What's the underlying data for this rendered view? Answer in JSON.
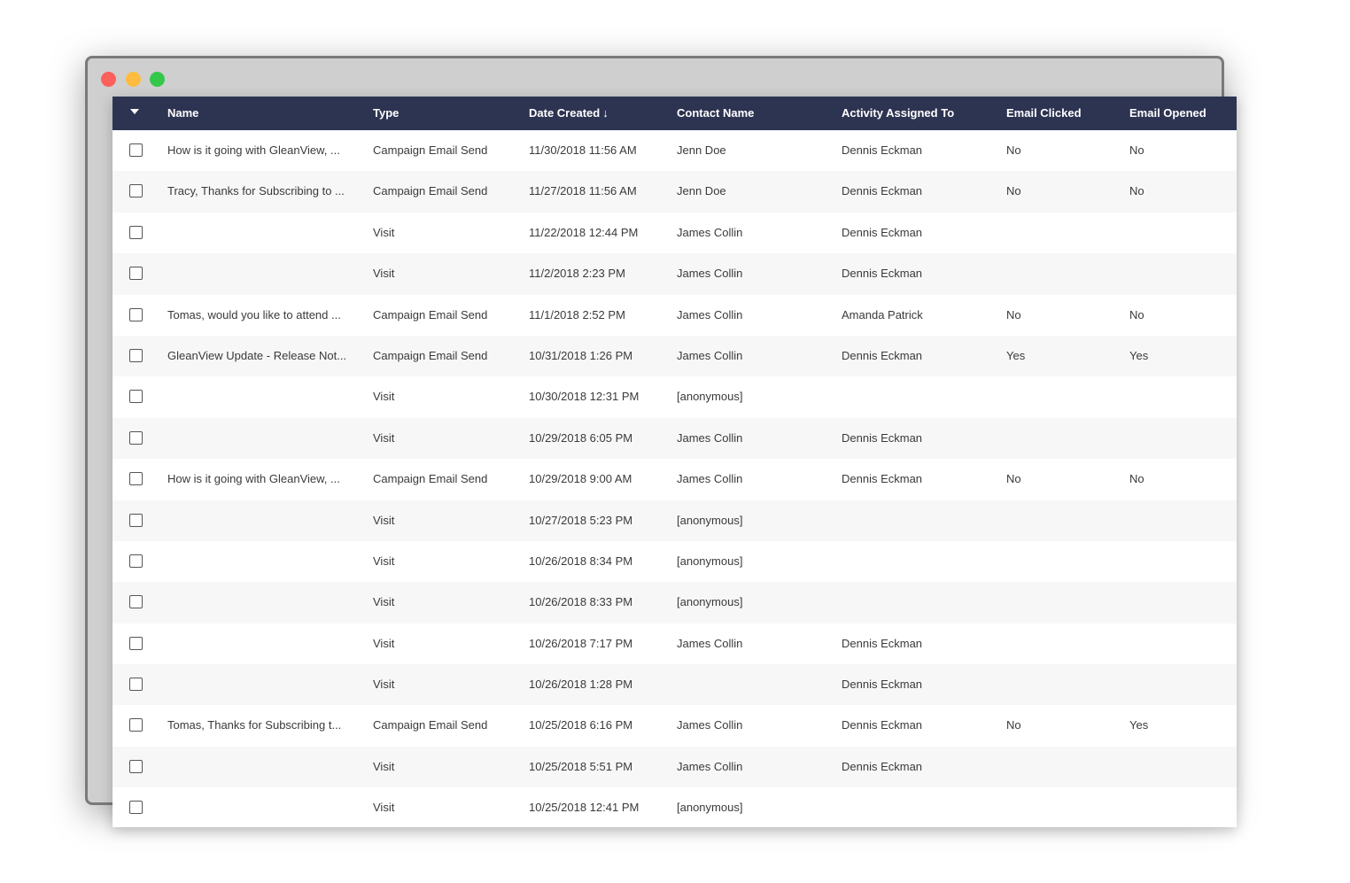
{
  "table": {
    "columns": {
      "name": "Name",
      "type": "Type",
      "date_created": "Date Created",
      "contact_name": "Contact Name",
      "activity_assigned_to": "Activity Assigned To",
      "email_clicked": "Email Clicked",
      "email_opened": "Email Opened"
    },
    "sort_indicator": "↓",
    "rows": [
      {
        "name": "How is it going with GleanView, ...",
        "type": "Campaign Email Send",
        "date": "11/30/2018 11:56 AM",
        "contact": "Jenn Doe",
        "assigned": "Dennis Eckman",
        "clicked": "No",
        "opened": "No"
      },
      {
        "name": "Tracy, Thanks for Subscribing to ...",
        "type": "Campaign Email Send",
        "date": "11/27/2018 11:56 AM",
        "contact": "Jenn Doe",
        "assigned": "Dennis Eckman",
        "clicked": "No",
        "opened": "No"
      },
      {
        "name": "",
        "type": "Visit",
        "date": "11/22/2018 12:44 PM",
        "contact": "James Collin",
        "assigned": "Dennis Eckman",
        "clicked": "",
        "opened": ""
      },
      {
        "name": "",
        "type": "Visit",
        "date": "11/2/2018 2:23 PM",
        "contact": "James Collin",
        "assigned": "Dennis Eckman",
        "clicked": "",
        "opened": ""
      },
      {
        "name": "Tomas, would you like to attend ...",
        "type": "Campaign Email Send",
        "date": "11/1/2018 2:52 PM",
        "contact": "James Collin",
        "assigned": "Amanda Patrick",
        "clicked": "No",
        "opened": "No"
      },
      {
        "name": "GleanView Update - Release Not...",
        "type": "Campaign Email Send",
        "date": "10/31/2018 1:26 PM",
        "contact": "James Collin",
        "assigned": "Dennis Eckman",
        "clicked": "Yes",
        "opened": "Yes"
      },
      {
        "name": "",
        "type": "Visit",
        "date": "10/30/2018 12:31 PM",
        "contact": "[anonymous]",
        "assigned": "",
        "clicked": "",
        "opened": ""
      },
      {
        "name": "",
        "type": "Visit",
        "date": "10/29/2018 6:05 PM",
        "contact": "James Collin",
        "assigned": "Dennis Eckman",
        "clicked": "",
        "opened": ""
      },
      {
        "name": "How is it going with GleanView, ...",
        "type": "Campaign Email Send",
        "date": "10/29/2018 9:00 AM",
        "contact": "James Collin",
        "assigned": "Dennis Eckman",
        "clicked": "No",
        "opened": "No"
      },
      {
        "name": "",
        "type": "Visit",
        "date": "10/27/2018 5:23 PM",
        "contact": "[anonymous]",
        "assigned": "",
        "clicked": "",
        "opened": ""
      },
      {
        "name": "",
        "type": "Visit",
        "date": "10/26/2018 8:34 PM",
        "contact": "[anonymous]",
        "assigned": "",
        "clicked": "",
        "opened": ""
      },
      {
        "name": "",
        "type": "Visit",
        "date": "10/26/2018 8:33 PM",
        "contact": "[anonymous]",
        "assigned": "",
        "clicked": "",
        "opened": ""
      },
      {
        "name": "",
        "type": "Visit",
        "date": "10/26/2018 7:17 PM",
        "contact": "James Collin",
        "assigned": "Dennis Eckman",
        "clicked": "",
        "opened": ""
      },
      {
        "name": "",
        "type": "Visit",
        "date": "10/26/2018 1:28 PM",
        "contact": "",
        "assigned": "Dennis Eckman",
        "clicked": "",
        "opened": ""
      },
      {
        "name": "Tomas, Thanks for Subscribing t...",
        "type": "Campaign Email Send",
        "date": "10/25/2018 6:16 PM",
        "contact": "James Collin",
        "assigned": "Dennis Eckman",
        "clicked": "No",
        "opened": "Yes"
      },
      {
        "name": "",
        "type": "Visit",
        "date": "10/25/2018 5:51 PM",
        "contact": "James Collin",
        "assigned": "Dennis Eckman",
        "clicked": "",
        "opened": ""
      },
      {
        "name": "",
        "type": "Visit",
        "date": "10/25/2018 12:41 PM",
        "contact": "[anonymous]",
        "assigned": "",
        "clicked": "",
        "opened": ""
      }
    ]
  },
  "colors": {
    "header_bg": "#2d3452",
    "row_alt": "#f7f7f7",
    "close": "#fc605c",
    "minimize": "#fdbc40",
    "maximize": "#34c84a"
  }
}
